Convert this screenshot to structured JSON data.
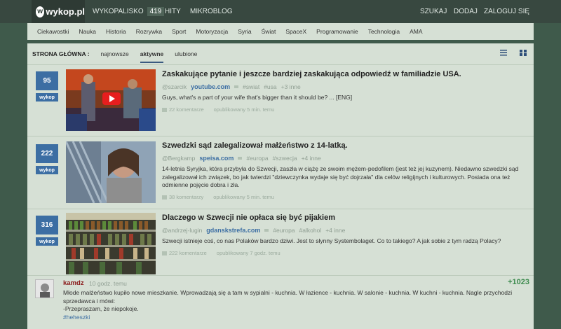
{
  "header": {
    "logo": "wykop.pl",
    "nav_left": [
      {
        "label": "WYKOPALISKO",
        "badge": "419"
      },
      {
        "label": "HITY"
      },
      {
        "label": "MIKROBLOG"
      }
    ],
    "nav_right": [
      "SZUKAJ",
      "DODAJ",
      "ZALOGUJ SIĘ"
    ]
  },
  "categories": [
    "Ciekawostki",
    "Nauka",
    "Historia",
    "Rozrywka",
    "Sport",
    "Motoryzacja",
    "Syria",
    "Świat",
    "SpaceX",
    "Programowanie",
    "Technologia",
    "AMA"
  ],
  "sort": {
    "label": "STRONA GŁÓWNA :",
    "tabs": [
      "najnowsze",
      "aktywne",
      "ulubione"
    ],
    "active": "aktywne"
  },
  "articles": [
    {
      "votes": "95",
      "vote_label": "wykop",
      "title": "Zaskakujące pytanie i jeszcze bardziej zaskakująca odpowiedź w familiadzie USA.",
      "author": "@szarcik",
      "source": "youtube.com",
      "tags": [
        "#swiat",
        "#usa"
      ],
      "more": "+3 inne",
      "description": "Guys, what's a part of your wife that's bigger than it should be? ... [ENG]",
      "comments": "22 komentarze",
      "published": "opublikowany 5 min. temu"
    },
    {
      "votes": "222",
      "vote_label": "wykop",
      "title": "Szwedzki sąd zalegalizował małżeństwo z 14-latką.",
      "author": "@Bergkamp",
      "source": "speisa.com",
      "tags": [
        "#europa",
        "#szwecja"
      ],
      "more": "+4 inne",
      "description": "14-letnia Syryjka, która przybyła do Szwecji, zaszła w ciążę ze swoim mężem-pedofilem (jest też jej kuzynem). Niedawno szwedzki sąd zalegalizował ich związek, bo jak twierdzi \"dziewczynka wydaje się być dojrzała\" dla celów religijnych i kulturowych. Posiada ona też odmienne pojęcie dobra i zła.",
      "comments": "38 komentarzy",
      "published": "opublikowany 5 min. temu"
    },
    {
      "votes": "316",
      "vote_label": "wykop",
      "title": "Dlaczego w Szwecji nie opłaca się być pijakiem",
      "author": "@andrzej-lugin",
      "source": "gdanskstrefa.com",
      "tags": [
        "#europa",
        "#alkohol"
      ],
      "more": "+4 inne",
      "description": "Szwecji istnieje coś, co nas Polaków bardzo dziwi. Jest to słynny Systembolaget. Co to takiego? A jak sobie z tym radzą Polacy?",
      "comments": "222 komentarze",
      "published": "opublikowany 7 godz. temu"
    }
  ],
  "entry": {
    "author": "kamdz",
    "time": "10 godz. temu",
    "score": "+1023",
    "lines": [
      "Młode małżeństwo kupiło nowe mieszkanie. Wprowadzają się a tam w sypialni - kuchnia. W łazience - kuchnia. W salonie - kuchnia. W kuchni - kuchnia. Nagle przychodzi sprzedawca i mówi:",
      "-Przepraszam, że niepokoje."
    ],
    "tag": "#heheszki"
  },
  "colors": {
    "background": "#3f5a4b",
    "topbar": "#384840",
    "content": "#d6e0d5",
    "accent": "#3c6ea3",
    "author": "#8a1a1a",
    "score": "#3c8a4d"
  }
}
